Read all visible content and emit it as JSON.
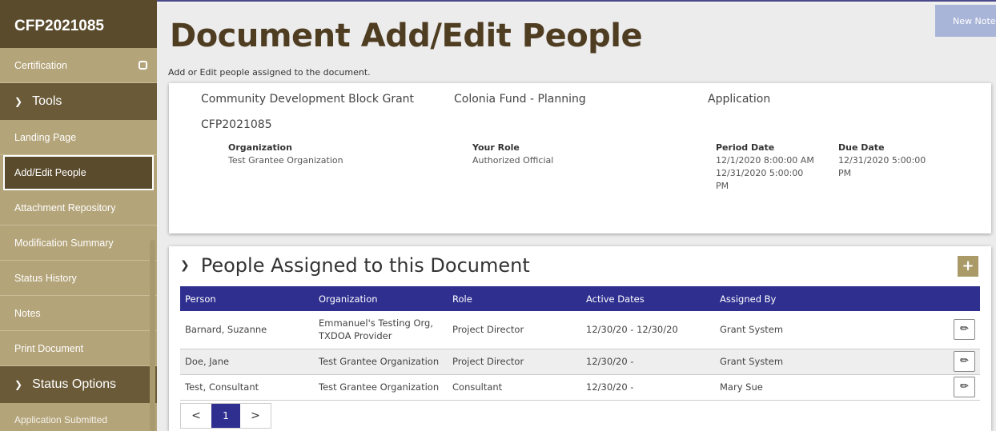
{
  "sidebar": {
    "header": "CFP2021085",
    "certification": "Certification",
    "tools_section": "Tools",
    "tools_items": [
      "Landing Page",
      "Add/Edit People",
      "Attachment Repository",
      "Modification Summary",
      "Status History",
      "Notes",
      "Print Document"
    ],
    "status_section": "Status Options",
    "status_partial": "Application Submitted"
  },
  "header": {
    "title": "Document Add/Edit People",
    "subtitle": "Add or Edit people assigned to the document.",
    "new_note": "New Note"
  },
  "document": {
    "program": "Community Development Block Grant",
    "fund": "Colonia Fund - Planning",
    "type": "Application",
    "id": "CFP2021085",
    "organization_label": "Organization",
    "organization_value": "Test Grantee Organization",
    "role_label": "Your Role",
    "role_value": "Authorized Official",
    "period_label": "Period Date",
    "period_start": "12/1/2020 8:00:00 AM",
    "period_end": "12/31/2020 5:00:00 PM",
    "due_label": "Due Date",
    "due_value": "12/31/2020 5:00:00 PM"
  },
  "people": {
    "title": "People Assigned to this Document",
    "add_label": "+",
    "columns": [
      "Person",
      "Organization",
      "Role",
      "Active Dates",
      "Assigned By"
    ],
    "rows": [
      {
        "person": "Barnard, Suzanne",
        "organization": "Emmanuel's Testing Org, TXDOA Provider",
        "role": "Project Director",
        "dates": "12/30/20 - 12/30/20",
        "assigned_by": "Grant System"
      },
      {
        "person": "Doe, Jane",
        "organization": "Test Grantee Organization",
        "role": "Project Director",
        "dates": "12/30/20 -",
        "assigned_by": "Grant System"
      },
      {
        "person": "Test, Consultant",
        "organization": "Test Grantee Organization",
        "role": "Consultant",
        "dates": "12/30/20 -",
        "assigned_by": "Mary Sue"
      }
    ],
    "pager": {
      "prev": "<",
      "current": "1",
      "next": ">"
    }
  },
  "colors": {
    "sidebar": "#b4a479",
    "sidebar_dark": "#5a4b2c",
    "title": "#4f3d22",
    "table_header": "#2e2f8f",
    "add_button": "#a99a68"
  },
  "icons": {
    "chevron": "chevron-down-icon",
    "toggle": "toggle-icon",
    "edit": "pencil-icon"
  }
}
